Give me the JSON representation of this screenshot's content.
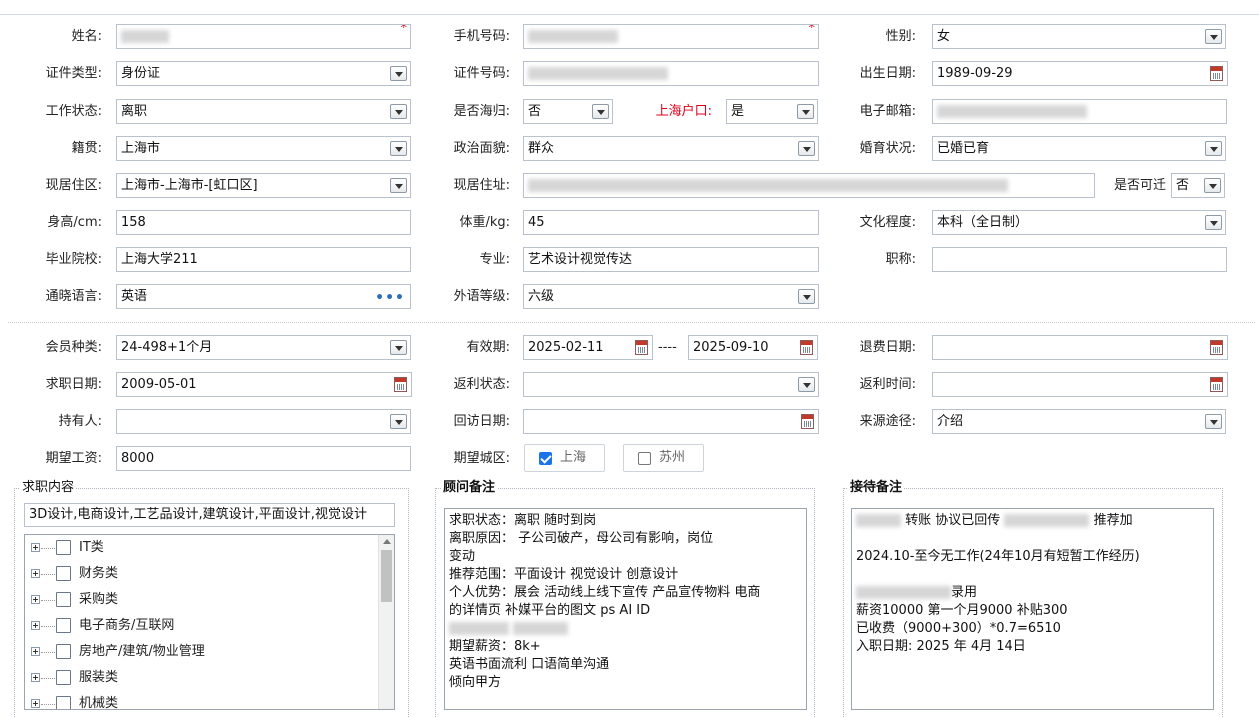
{
  "personal": {
    "name_label": "姓名:",
    "phone_label": "手机号码:",
    "gender_label": "性别:",
    "gender_value": "女",
    "id_type_label": "证件类型:",
    "id_type_value": "身份证",
    "id_number_label": "证件号码:",
    "birth_label": "出生日期:",
    "birth_value": "1989-09-29",
    "work_status_label": "工作状态:",
    "work_status_value": "离职",
    "returnee_label": "是否海归:",
    "returnee_value": "否",
    "hukou_label": "上海户口:",
    "hukou_value": "是",
    "email_label": "电子邮箱:",
    "native_label": "籍贯:",
    "native_value": "上海市",
    "political_label": "政治面貌:",
    "political_value": "群众",
    "marital_label": "婚育状况:",
    "marital_value": "已婚已育",
    "residence_area_label": "现居住区:",
    "residence_area_value": "上海市-上海市-[虹口区]",
    "residence_addr_label": "现居住址:",
    "relocate_label": "是否可迁",
    "relocate_value": "否",
    "height_label": "身高/cm:",
    "height_value": "158",
    "weight_label": "体重/kg:",
    "weight_value": "45",
    "education_label": "文化程度:",
    "education_value": "本科（全日制）",
    "school_label": "毕业院校:",
    "school_value": "上海大学211",
    "major_label": "专业:",
    "major_value": "艺术设计视觉传达",
    "title_label": "职称:",
    "title_value": "",
    "language_label": "通晓语言:",
    "language_value": "英语",
    "language_more": "•••",
    "fl_level_label": "外语等级:",
    "fl_level_value": "六级"
  },
  "membership": {
    "type_label": "会员种类:",
    "type_value": "24-498+1个月",
    "valid_label": "有效期:",
    "valid_from": "2025-02-11",
    "valid_sep": "----",
    "valid_to": "2025-09-10",
    "refund_date_label": "退费日期:",
    "refund_date_value": "",
    "job_date_label": "求职日期:",
    "job_date_value": "2009-05-01",
    "rebate_status_label": "返利状态:",
    "rebate_status_value": "",
    "rebate_time_label": "返利时间:",
    "rebate_time_value": "",
    "holder_label": "持有人:",
    "holder_value": "",
    "revisit_label": "回访日期:",
    "revisit_value": "",
    "source_label": "来源途径:",
    "source_value": "介绍",
    "salary_label": "期望工资:",
    "salary_value": "8000",
    "city_label": "期望城区:",
    "city_options": [
      {
        "label": "上海",
        "checked": true
      },
      {
        "label": "苏州",
        "checked": false
      }
    ]
  },
  "job_content": {
    "title": "求职内容",
    "summary": "3D设计,电商设计,工艺品设计,建筑设计,平面设计,视觉设计",
    "tree": [
      "IT类",
      "财务类",
      "采购类",
      "电子商务/互联网",
      "房地产/建筑/物业管理",
      "服装类",
      "机械类"
    ]
  },
  "consultant_notes": {
    "title": "顾问备注",
    "lines": [
      "求职状态：离职  随时到岗",
      "离职原因：      子公司破产，母公司有影响，岗位",
      "变动",
      "推荐范围：平面设计 视觉设计   创意设计",
      "个人优势：展会 活动线上线下宣传 产品宣传物料  电商",
      "的详情页 补媒平台的图文  ps AI ID",
      "",
      "期望薪资：8k+",
      "英语书面流利 口语简单沟通",
      "倾向甲方"
    ]
  },
  "reception_notes": {
    "title": "接待备注",
    "line1_a": "转账 协议已回传",
    "line1_b": "推荐加",
    "line2": "",
    "line3": "2024.10-至今无工作(24年10月有短暂工作经历)",
    "line4": "",
    "line5": "录用",
    "line6": "薪资10000 第一个月9000  补贴300",
    "line7": "已收费（9000+300）*0.7=6510",
    "line8": "入职日期:  2025 年 4月 14日"
  }
}
